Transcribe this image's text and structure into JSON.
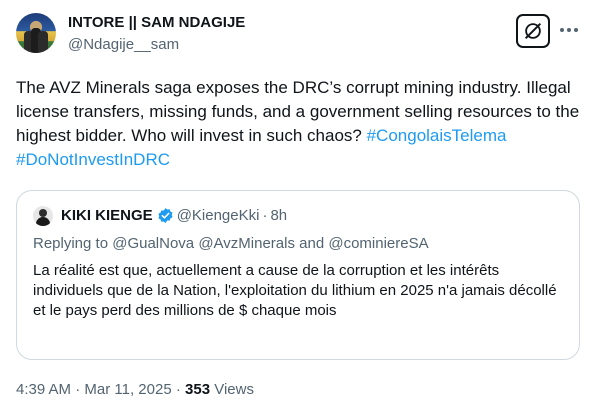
{
  "author": {
    "name": "INTORE || SAM NDAGIJE",
    "handle": "@Ndagije__sam"
  },
  "tweet": {
    "text_plain": "The AVZ Minerals saga exposes the DRC’s corrupt mining industry. Illegal license transfers, missing funds, and a government selling resources to the highest bidder. Who will invest in such chaos?",
    "hashtag_1": "#CongolaisTelema",
    "hashtag_2": "#DoNotInvestInDRC"
  },
  "quote": {
    "name": "KIKI KIENGE",
    "handle": "@KiengeKki",
    "separator": "·",
    "time": "8h",
    "replying_prefix": "Replying to",
    "mention_1": "@GualNova",
    "mention_2": "@AvzMinerals",
    "replying_and": "and",
    "mention_3": "@cominiereSA",
    "text": "La réalité est que, actuellement a cause de la corruption et les intérêts individuels que de la Nation, l'exploitation du lithium en 2025 n'a jamais décollé et le pays perd des millions de $ chaque mois"
  },
  "meta": {
    "time": "4:39 AM",
    "separator_1": "·",
    "date": "Mar 11, 2025",
    "separator_2": "·",
    "views_count": "353",
    "views_label": "Views"
  },
  "icons": {
    "grok": "grok-icon",
    "more": "more-horizontal-icon",
    "verified": "verified-badge-icon"
  },
  "colors": {
    "link": "#1d9bf0",
    "text": "#0f1419",
    "secondary": "#536471",
    "border": "#cfd9de"
  }
}
